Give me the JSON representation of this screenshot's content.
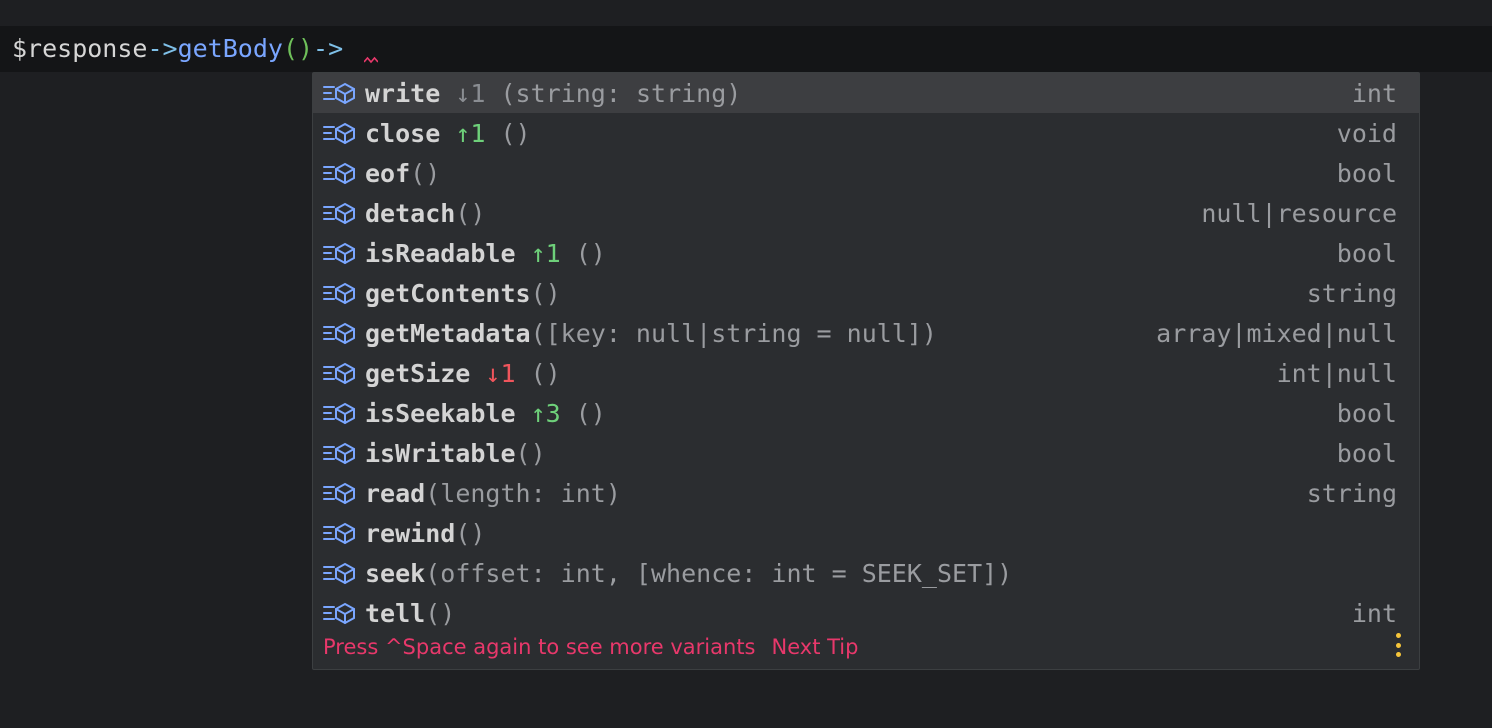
{
  "editor": {
    "code_var": "$response",
    "code_arrow1": "->",
    "code_method": "getBody",
    "code_parens": "()",
    "code_arrow2": "->"
  },
  "completion": {
    "icon": "method-icon",
    "items": [
      {
        "name": "write",
        "order": "↓1",
        "order_kind": "neutral",
        "params": "(string: string)",
        "returns": "int",
        "selected": true
      },
      {
        "name": "close",
        "order": "↑1",
        "order_kind": "up",
        "params": "()",
        "returns": "void"
      },
      {
        "name": "eof",
        "order": "",
        "order_kind": "",
        "params": "()",
        "returns": "bool"
      },
      {
        "name": "detach",
        "order": "",
        "order_kind": "",
        "params": "()",
        "returns": "null|resource"
      },
      {
        "name": "isReadable",
        "order": "↑1",
        "order_kind": "up",
        "params": "()",
        "returns": "bool"
      },
      {
        "name": "getContents",
        "order": "",
        "order_kind": "",
        "params": "()",
        "returns": "string"
      },
      {
        "name": "getMetadata",
        "order": "",
        "order_kind": "",
        "params": "([key: null|string = null])",
        "returns": "array|mixed|null"
      },
      {
        "name": "getSize",
        "order": "↓1",
        "order_kind": "down",
        "params": "()",
        "returns": "int|null"
      },
      {
        "name": "isSeekable",
        "order": "↑3",
        "order_kind": "up",
        "params": "()",
        "returns": "bool"
      },
      {
        "name": "isWritable",
        "order": "",
        "order_kind": "",
        "params": "()",
        "returns": "bool"
      },
      {
        "name": "read",
        "order": "",
        "order_kind": "",
        "params": "(length: int)",
        "returns": "string"
      },
      {
        "name": "rewind",
        "order": "",
        "order_kind": "",
        "params": "()",
        "returns": ""
      },
      {
        "name": "seek",
        "order": "",
        "order_kind": "",
        "params": "(offset: int, [whence: int = SEEK_SET])",
        "returns": ""
      },
      {
        "name": "tell",
        "order": "",
        "order_kind": "",
        "params": "()",
        "returns": "int"
      }
    ],
    "footer_hint": "Press ^Space again to see more variants",
    "footer_link": "Next Tip"
  },
  "colors": {
    "accent_pink": "#e8386b",
    "order_up": "#6ed07a",
    "order_down": "#f0555c",
    "icon_blue": "#7aa6ff",
    "kebab_yellow": "#f6c53a"
  }
}
